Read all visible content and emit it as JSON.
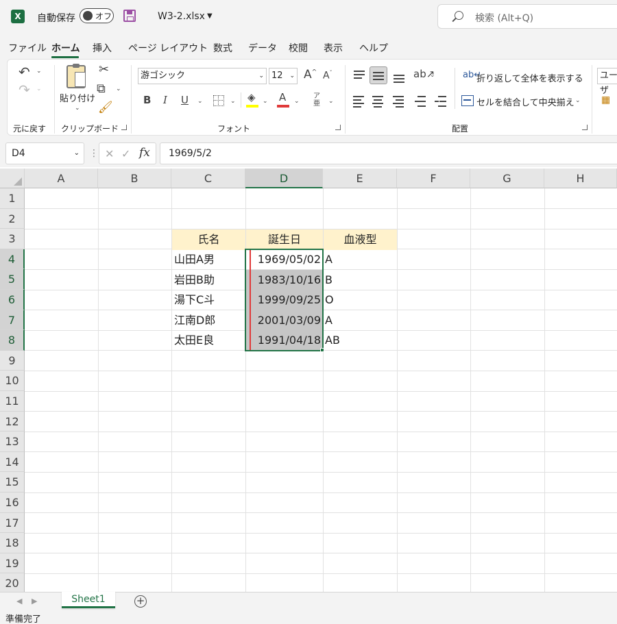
{
  "titlebar": {
    "autosave_label": "自動保存",
    "autosave_state": "オフ",
    "filename": "W3-2.xlsx",
    "search_placeholder": "検索 (Alt+Q)"
  },
  "menu": {
    "items": [
      "ファイル",
      "ホーム",
      "挿入",
      "ページ レイアウト",
      "数式",
      "データ",
      "校閲",
      "表示",
      "ヘルプ"
    ],
    "active": "ホーム"
  },
  "ribbon": {
    "undo_group_label": "元に戻す",
    "clipboard": {
      "paste_label": "貼り付け",
      "group_label": "クリップボード"
    },
    "font": {
      "family": "游ゴシック",
      "size": "12",
      "group_label": "フォント",
      "fill_color": "#ffff00",
      "font_color": "#e03a3a"
    },
    "alignment": {
      "wrap_label": "折り返して全体を表示する",
      "merge_label": "セルを結合して中央揃え",
      "group_label": "配置"
    },
    "number_format_partial": "ユーザ"
  },
  "formula_bar": {
    "name_box": "D4",
    "formula": "1969/5/2"
  },
  "sheet": {
    "columns": [
      "A",
      "B",
      "C",
      "D",
      "E",
      "F",
      "G",
      "H"
    ],
    "selected_column": "D",
    "rows": [
      "1",
      "2",
      "3",
      "4",
      "5",
      "6",
      "7",
      "8",
      "9",
      "10",
      "11",
      "12",
      "13",
      "14",
      "15",
      "16",
      "17",
      "18",
      "19",
      "20"
    ],
    "selected_rows": [
      "4",
      "5",
      "6",
      "7",
      "8"
    ],
    "table": {
      "headers": [
        "氏名",
        "誕生日",
        "血液型"
      ],
      "records": [
        [
          "山田A男",
          "1969/05/02",
          "A"
        ],
        [
          "岩田B助",
          "1983/10/16",
          "B"
        ],
        [
          "湯下C斗",
          "1999/09/25",
          "O"
        ],
        [
          "江南D郎",
          "2001/03/09",
          "A"
        ],
        [
          "太田E良",
          "1991/04/18",
          "AB"
        ]
      ]
    }
  },
  "tabs": {
    "sheets": [
      "Sheet1"
    ],
    "active": "Sheet1"
  },
  "status": {
    "text": "準備完了"
  },
  "colors": {
    "accent": "#217346",
    "header_fill": "#fff2cc",
    "selection_fill": "#c6c6c6"
  }
}
